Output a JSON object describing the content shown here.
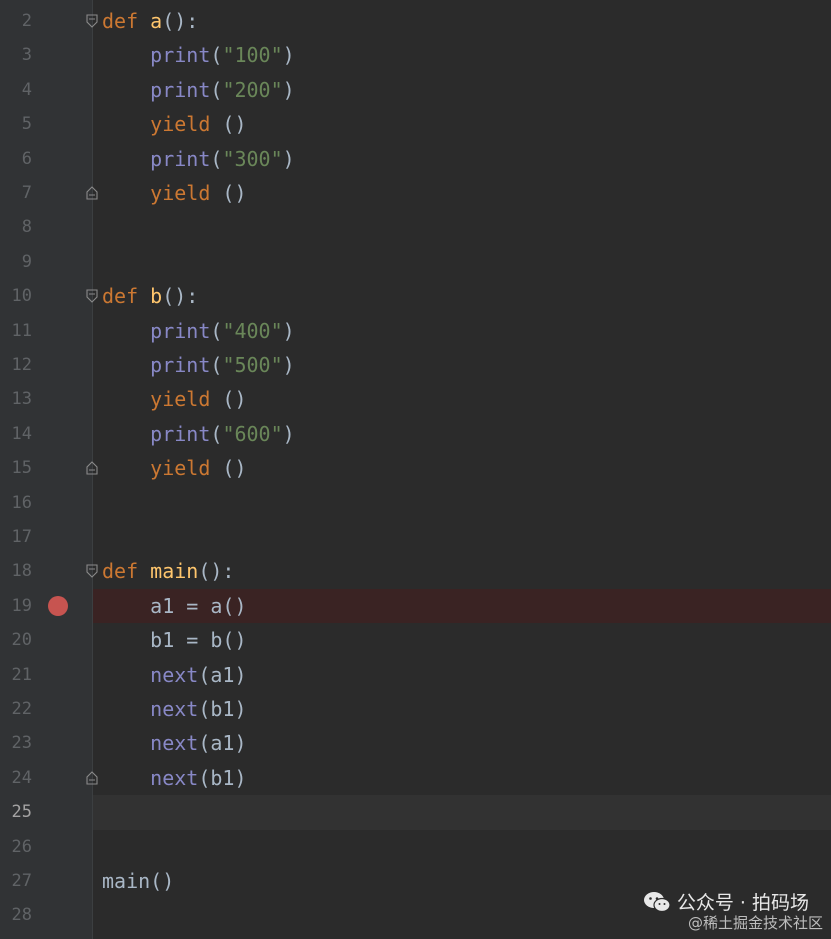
{
  "lines": [
    {
      "n": "2",
      "fold": "open",
      "tokens": [
        [
          "kw",
          "def "
        ],
        [
          "fn",
          "a"
        ],
        [
          "plain",
          "():"
        ]
      ]
    },
    {
      "n": "3",
      "tokens": [
        [
          "plain",
          "    "
        ],
        [
          "builtin",
          "print"
        ],
        [
          "plain",
          "("
        ],
        [
          "str",
          "\"100\""
        ],
        [
          "plain",
          ")"
        ]
      ]
    },
    {
      "n": "4",
      "tokens": [
        [
          "plain",
          "    "
        ],
        [
          "builtin",
          "print"
        ],
        [
          "plain",
          "("
        ],
        [
          "str",
          "\"200\""
        ],
        [
          "plain",
          ")"
        ]
      ]
    },
    {
      "n": "5",
      "tokens": [
        [
          "plain",
          "    "
        ],
        [
          "kw",
          "yield"
        ],
        [
          "plain",
          " ()"
        ]
      ]
    },
    {
      "n": "6",
      "tokens": [
        [
          "plain",
          "    "
        ],
        [
          "builtin",
          "print"
        ],
        [
          "plain",
          "("
        ],
        [
          "str",
          "\"300\""
        ],
        [
          "plain",
          ")"
        ]
      ]
    },
    {
      "n": "7",
      "fold": "close",
      "tokens": [
        [
          "plain",
          "    "
        ],
        [
          "kw",
          "yield"
        ],
        [
          "plain",
          " ()"
        ]
      ]
    },
    {
      "n": "8",
      "tokens": []
    },
    {
      "n": "9",
      "tokens": []
    },
    {
      "n": "10",
      "fold": "open",
      "tokens": [
        [
          "kw",
          "def "
        ],
        [
          "fn",
          "b"
        ],
        [
          "plain",
          "():"
        ]
      ]
    },
    {
      "n": "11",
      "tokens": [
        [
          "plain",
          "    "
        ],
        [
          "builtin",
          "print"
        ],
        [
          "plain",
          "("
        ],
        [
          "str",
          "\"400\""
        ],
        [
          "plain",
          ")"
        ]
      ]
    },
    {
      "n": "12",
      "tokens": [
        [
          "plain",
          "    "
        ],
        [
          "builtin",
          "print"
        ],
        [
          "plain",
          "("
        ],
        [
          "str",
          "\"500\""
        ],
        [
          "plain",
          ")"
        ]
      ]
    },
    {
      "n": "13",
      "tokens": [
        [
          "plain",
          "    "
        ],
        [
          "kw",
          "yield"
        ],
        [
          "plain",
          " ()"
        ]
      ]
    },
    {
      "n": "14",
      "tokens": [
        [
          "plain",
          "    "
        ],
        [
          "builtin",
          "print"
        ],
        [
          "plain",
          "("
        ],
        [
          "str",
          "\"600\""
        ],
        [
          "plain",
          ")"
        ]
      ]
    },
    {
      "n": "15",
      "fold": "close",
      "tokens": [
        [
          "plain",
          "    "
        ],
        [
          "kw",
          "yield"
        ],
        [
          "plain",
          " ()"
        ]
      ]
    },
    {
      "n": "16",
      "tokens": []
    },
    {
      "n": "17",
      "tokens": []
    },
    {
      "n": "18",
      "fold": "open",
      "tokens": [
        [
          "kw",
          "def "
        ],
        [
          "fn",
          "main"
        ],
        [
          "plain",
          "():"
        ]
      ]
    },
    {
      "n": "19",
      "breakpoint": true,
      "tokens": [
        [
          "plain",
          "    a1 = a()"
        ]
      ]
    },
    {
      "n": "20",
      "tokens": [
        [
          "plain",
          "    b1 = b()"
        ]
      ]
    },
    {
      "n": "21",
      "tokens": [
        [
          "plain",
          "    "
        ],
        [
          "builtin",
          "next"
        ],
        [
          "plain",
          "(a1)"
        ]
      ]
    },
    {
      "n": "22",
      "tokens": [
        [
          "plain",
          "    "
        ],
        [
          "builtin",
          "next"
        ],
        [
          "plain",
          "(b1)"
        ]
      ]
    },
    {
      "n": "23",
      "tokens": [
        [
          "plain",
          "    "
        ],
        [
          "builtin",
          "next"
        ],
        [
          "plain",
          "(a1)"
        ]
      ]
    },
    {
      "n": "24",
      "fold": "close",
      "tokens": [
        [
          "plain",
          "    "
        ],
        [
          "builtin",
          "next"
        ],
        [
          "plain",
          "(b1)"
        ]
      ]
    },
    {
      "n": "25",
      "current": true,
      "tokens": []
    },
    {
      "n": "26",
      "tokens": []
    },
    {
      "n": "27",
      "tokens": [
        [
          "plain",
          "main()"
        ]
      ]
    },
    {
      "n": "28",
      "tokens": []
    }
  ],
  "colors": {
    "background": "#2b2b2b",
    "keyword": "#cc7832",
    "function": "#ffc66d",
    "builtin": "#8888c6",
    "string": "#6a8759",
    "breakpoint": "#c75450"
  },
  "watermark": {
    "icon": "wechat-icon",
    "text": "公众号 · 拍码场",
    "subtext": "@稀土掘金技术社区"
  }
}
